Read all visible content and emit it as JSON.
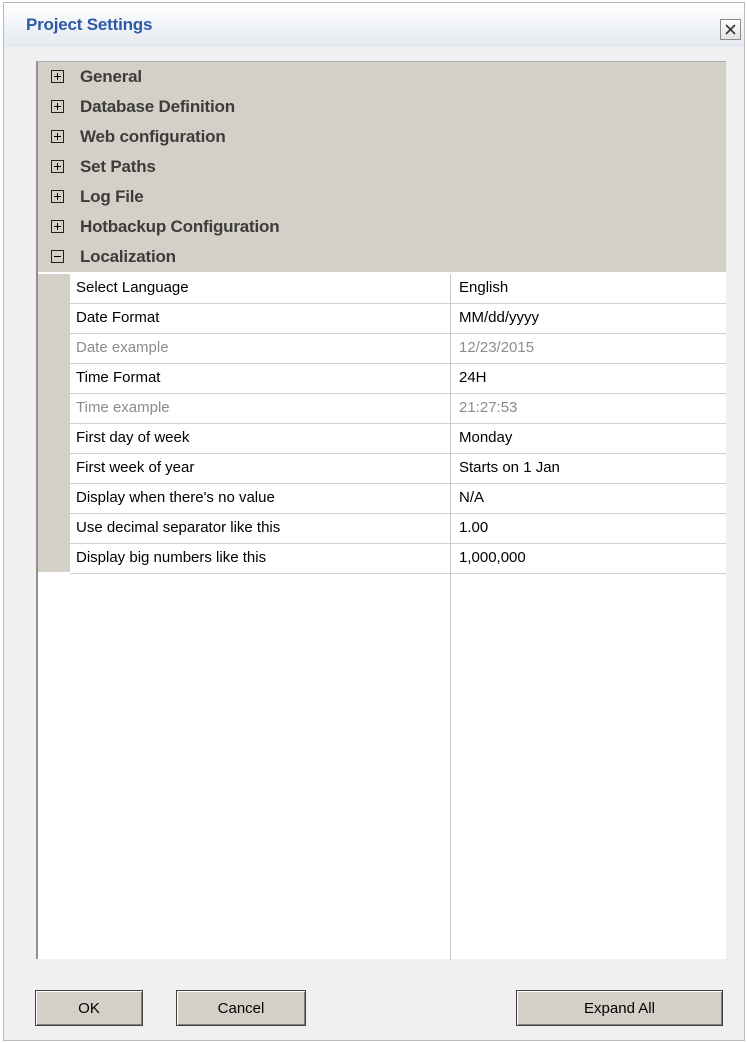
{
  "window": {
    "title": "Project Settings",
    "close_icon": "close-icon"
  },
  "categories": [
    {
      "label": "General",
      "expanded": false
    },
    {
      "label": "Database Definition",
      "expanded": false
    },
    {
      "label": "Web configuration",
      "expanded": false
    },
    {
      "label": "Set Paths",
      "expanded": false
    },
    {
      "label": "Log File",
      "expanded": false
    },
    {
      "label": "Hotbackup Configuration",
      "expanded": false
    },
    {
      "label": "Localization",
      "expanded": true
    }
  ],
  "properties": [
    {
      "name": "Select Language",
      "value": "English",
      "readonly": false
    },
    {
      "name": "Date Format",
      "value": "MM/dd/yyyy",
      "readonly": false
    },
    {
      "name": "Date example",
      "value": "12/23/2015",
      "readonly": true
    },
    {
      "name": "Time Format",
      "value": "24H",
      "readonly": false
    },
    {
      "name": "Time example",
      "value": "21:27:53",
      "readonly": true
    },
    {
      "name": "First day of week",
      "value": "Monday",
      "readonly": false
    },
    {
      "name": "First week of year",
      "value": "Starts on 1 Jan",
      "readonly": false
    },
    {
      "name": "Display when there's no value",
      "value": "N/A",
      "readonly": false
    },
    {
      "name": "Use decimal separator like this",
      "value": "1.00",
      "readonly": false
    },
    {
      "name": "Display big numbers like this",
      "value": "1,000,000",
      "readonly": false
    }
  ],
  "buttons": {
    "ok": "OK",
    "cancel": "Cancel",
    "expand_all": "Expand All"
  },
  "colors": {
    "title": "#2c5aa7",
    "category_bg": "#d4d0c8",
    "readonly_text": "#8c8c8c"
  }
}
